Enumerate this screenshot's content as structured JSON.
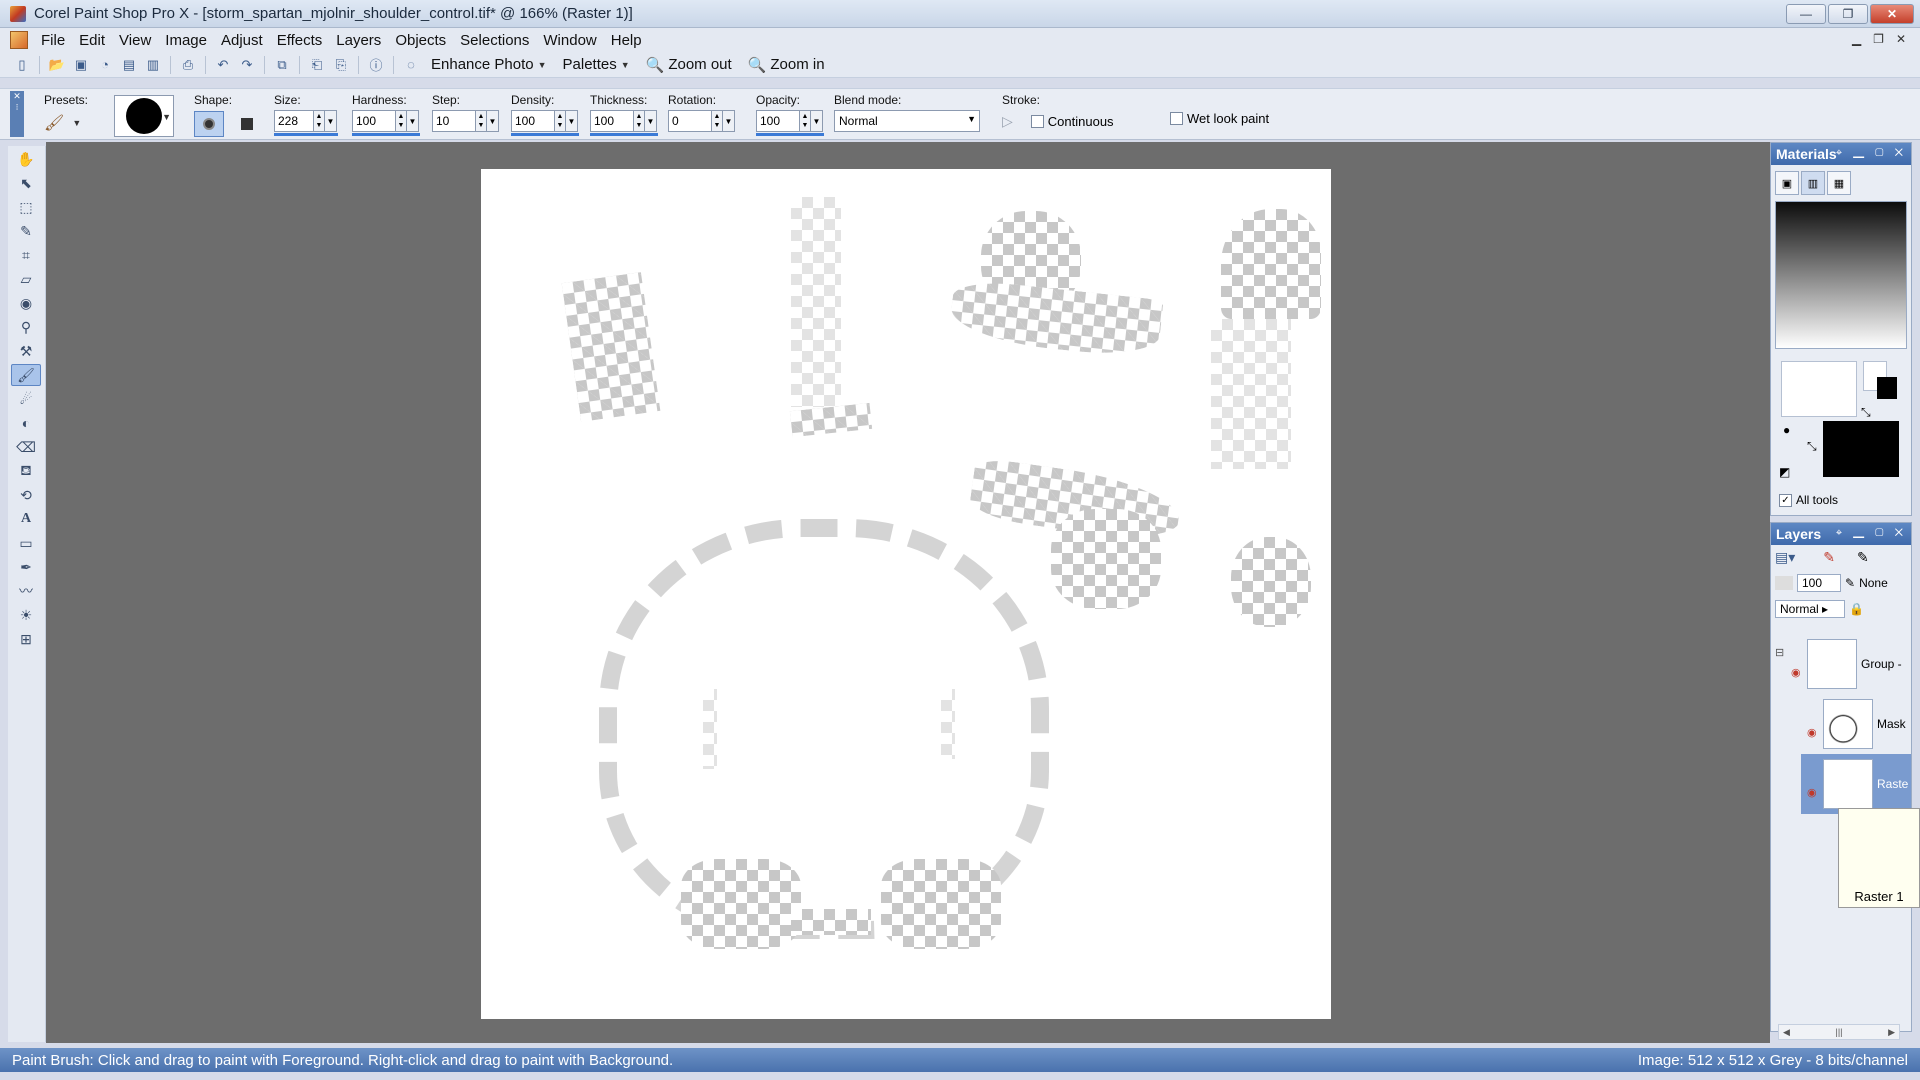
{
  "window": {
    "title": "Corel Paint Shop Pro X - [storm_spartan_mjolnir_shoulder_control.tif* @ 166% (Raster 1)]",
    "btn_min": "—",
    "btn_max": "❐",
    "btn_close": "✕"
  },
  "menu": [
    "File",
    "Edit",
    "View",
    "Image",
    "Adjust",
    "Effects",
    "Layers",
    "Objects",
    "Selections",
    "Window",
    "Help"
  ],
  "toolbar": {
    "enhance_photo": "Enhance Photo",
    "palettes": "Palettes",
    "zoom_out": "Zoom out",
    "zoom_in": "Zoom in"
  },
  "tool_options": {
    "presets_label": "Presets:",
    "shape_label": "Shape:",
    "size_label": "Size:",
    "size_value": "228",
    "hardness_label": "Hardness:",
    "hardness_value": "100",
    "step_label": "Step:",
    "step_value": "10",
    "density_label": "Density:",
    "density_value": "100",
    "thickness_label": "Thickness:",
    "thickness_value": "100",
    "rotation_label": "Rotation:",
    "rotation_value": "0",
    "opacity_label": "Opacity:",
    "opacity_value": "100",
    "blend_label": "Blend mode:",
    "blend_value": "Normal",
    "stroke_label": "Stroke:",
    "continuous_label": "Continuous",
    "wet_look_label": "Wet look paint"
  },
  "materials": {
    "title": "Materials",
    "all_tools_label": "All tools",
    "all_tools_checked": true
  },
  "layers": {
    "title": "Layers",
    "opacity": "100",
    "mask_mode": "None",
    "blend": "Normal",
    "items": [
      {
        "name": "Group -"
      },
      {
        "name": "Mask"
      },
      {
        "name": "Raste"
      }
    ],
    "tooltip": "Raster 1"
  },
  "status": {
    "hint": "Paint Brush: Click and drag to paint with Foreground. Right-click and drag to paint with Background.",
    "image_info": "Image:  512 x 512 x Grey - 8 bits/channel"
  },
  "colors": {
    "workspace": "#6d6d6d",
    "accent": "#3f6aab",
    "foreground": "#ffffff",
    "background": "#000000"
  }
}
